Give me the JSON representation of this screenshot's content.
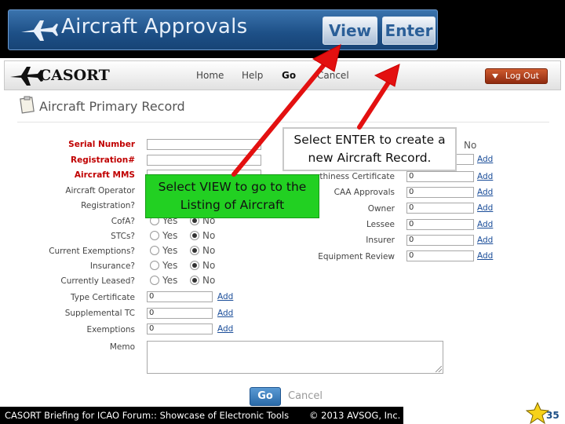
{
  "banner": {
    "title": "Aircraft Approvals",
    "view_label": "View",
    "enter_label": "Enter"
  },
  "topbar": {
    "logo": "CASORT",
    "nav": [
      "Home",
      "Help",
      "Go",
      "Cancel"
    ],
    "logout_label": "Log Out"
  },
  "record_title": "Aircraft Primary Record",
  "left_fields": [
    {
      "label": "Serial Number",
      "required": true
    },
    {
      "label": "Registration#",
      "required": true
    },
    {
      "label": "Aircraft MMS",
      "required": true
    },
    {
      "label": "Aircraft Operator",
      "required": false
    },
    {
      "label": "Registration?",
      "required": false
    }
  ],
  "radio_fields": [
    {
      "label": "CofA?",
      "yes": "Yes",
      "no": "No"
    },
    {
      "label": "STCs?",
      "yes": "Yes",
      "no": "No"
    },
    {
      "label": "Current Exemptions?",
      "yes": "Yes",
      "no": "No"
    },
    {
      "label": "Insurance?",
      "yes": "Yes",
      "no": "No"
    },
    {
      "label": "Currently Leased?",
      "yes": "Yes",
      "no": "No"
    }
  ],
  "count_fields": [
    {
      "label": "Type Certificate",
      "value": "0",
      "link": "Add"
    },
    {
      "label": "Supplemental TC",
      "value": "0",
      "link": "Add"
    },
    {
      "label": "Exemptions",
      "value": "0",
      "link": "Add"
    }
  ],
  "memo_label": "Memo",
  "right_top_no": "No",
  "right_fields": [
    {
      "label": "",
      "value": "",
      "link": "Add"
    },
    {
      "label": "rthiness Certificate",
      "value": "0",
      "link": "Add"
    },
    {
      "label": "CAA Approvals",
      "value": "0",
      "link": "Add"
    },
    {
      "label": "Owner",
      "value": "0",
      "link": "Add"
    },
    {
      "label": "Lessee",
      "value": "0",
      "link": "Add"
    },
    {
      "label": "Insurer",
      "value": "0",
      "link": "Add"
    },
    {
      "label": "Equipment Review",
      "value": "0",
      "link": "Add"
    }
  ],
  "form_buttons": {
    "go": "Go",
    "cancel": "Cancel"
  },
  "callouts": {
    "enter_line1": "Select ENTER to create a",
    "enter_line2": "new Aircraft Record.",
    "view_line1": "Select VIEW to go to the",
    "view_line2": "Listing of Aircraft"
  },
  "footer": {
    "text": "CASORT Briefing for ICAO Forum:: Showcase of Electronic Tools",
    "copyright": "© 2013 AVSOG, Inc.",
    "page": "35"
  },
  "colors": {
    "required": "#c00000",
    "link": "#1a4d99",
    "callout": "#22d022",
    "arrow": "#e31010"
  }
}
